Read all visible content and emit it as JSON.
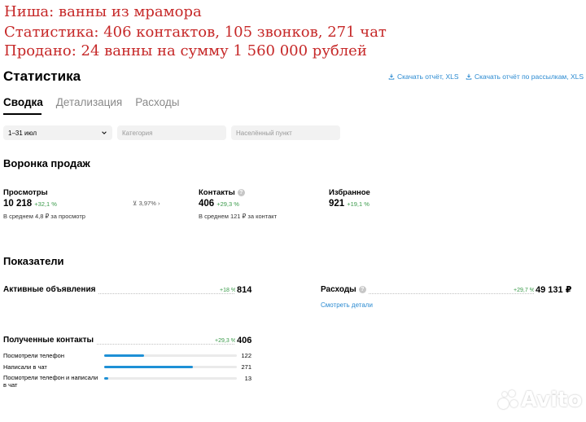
{
  "overlay": {
    "line1": "Ниша: ванны из мрамора",
    "line2": "Статистика: 406 контактов, 105 звонков, 271 чат",
    "line3": "Продано: 24 ванны на сумму 1 560 000 рублей"
  },
  "header": {
    "title": "Статистика",
    "download_report": "Скачать отчёт, XLS",
    "download_mailing_report": "Скачать отчёт по рассылкам, XLS"
  },
  "tabs": [
    "Сводка",
    "Детализация",
    "Расходы"
  ],
  "filters": {
    "period": "1–31 июл",
    "category_placeholder": "Категория",
    "city_placeholder": "Населённый пункт"
  },
  "funnel": {
    "title": "Воронка продаж",
    "views": {
      "label": "Просмотры",
      "value": "10 218",
      "delta": "+32,1 %",
      "sub": "В среднем 4,8 ₽ за просмотр"
    },
    "conversion": "3,97%",
    "contacts": {
      "label": "Контакты",
      "value": "406",
      "delta": "+29,3 %",
      "sub": "В среднем 121 ₽ за контакт"
    },
    "favorites": {
      "label": "Избранное",
      "value": "921",
      "delta": "+19,1 %"
    }
  },
  "indicators": {
    "title": "Показатели",
    "active_ads": {
      "label": "Активные объявления",
      "delta": "+18 %",
      "value": "814"
    },
    "expenses": {
      "label": "Расходы",
      "delta": "+29,7 %",
      "value": "49 131 ₽",
      "details_link": "Смотреть детали"
    },
    "received_contacts": {
      "label": "Полученные контакты",
      "delta": "+29,3 %",
      "value": "406",
      "rows": [
        {
          "label": "Посмотрели телефон",
          "value": "122",
          "share": 0.3
        },
        {
          "label": "Написали в чат",
          "value": "271",
          "share": 0.67
        },
        {
          "label": "Посмотрели телефон и написали в чат",
          "value": "13",
          "share": 0.03
        }
      ]
    }
  },
  "watermark": {
    "text": "Avito",
    "color": "#ffffff"
  },
  "colors": {
    "accent": "#2a8ad1",
    "positive": "#3a9a4a",
    "overlay_text": "#c62828",
    "bar": "#1e90d6"
  }
}
